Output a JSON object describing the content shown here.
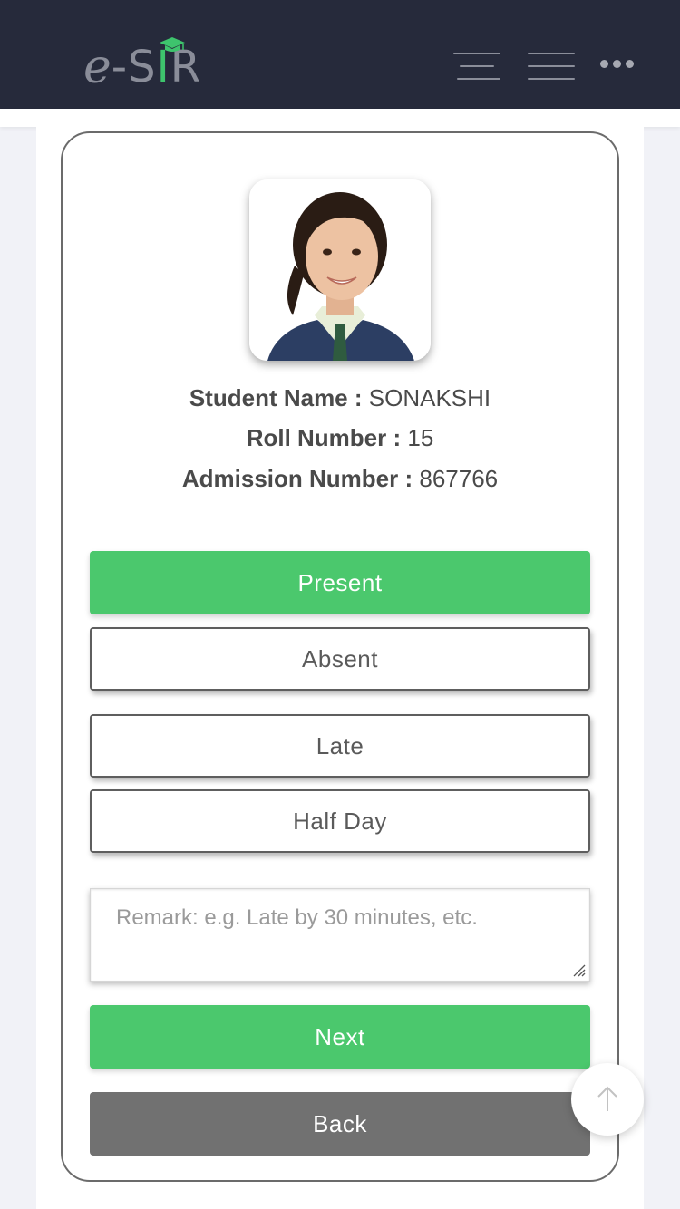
{
  "header": {
    "logo": {
      "prefix": "e",
      "dash": "-",
      "letters_s": "S",
      "letters_i": "I",
      "letters_r": "R"
    },
    "icons": [
      "graduation-cap-icon",
      "menu-icon",
      "menu-icon",
      "more-icon"
    ]
  },
  "student": {
    "name_label": "Student Name :",
    "name_value": "SONAKSHI",
    "roll_label": "Roll Number :",
    "roll_value": "15",
    "admission_label": "Admission Number :",
    "admission_value": "867766"
  },
  "attendance": {
    "present": "Present",
    "absent": "Absent",
    "late": "Late",
    "half_day": "Half Day",
    "selected": "Present"
  },
  "remark": {
    "placeholder": "Remark: e.g. Late by 30 minutes, etc.",
    "value": ""
  },
  "actions": {
    "next": "Next",
    "back": "Back"
  },
  "colors": {
    "header_bg": "#262a3b",
    "accent_green": "#4bc86d",
    "back_gray": "#717171"
  }
}
